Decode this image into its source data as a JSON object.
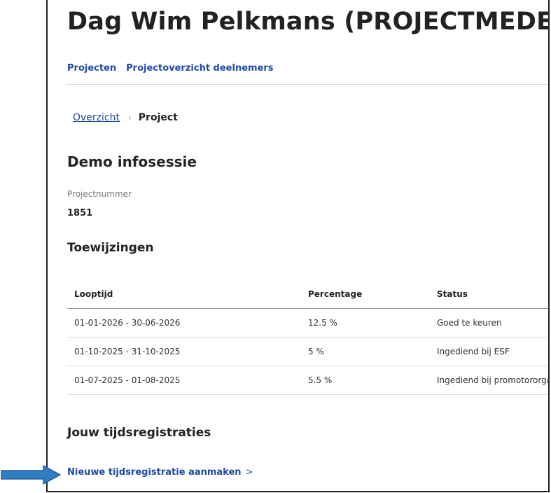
{
  "header": {
    "title": "Dag Wim Pelkmans (PROJECTMEDEWERKER)"
  },
  "nav": {
    "items": [
      {
        "label": "Projecten"
      },
      {
        "label": "Projectoverzicht deelnemers"
      }
    ]
  },
  "breadcrumb": {
    "parent": "Overzicht",
    "separator": "›",
    "current": "Project"
  },
  "project": {
    "title": "Demo infosessie",
    "number_label": "Projectnummer",
    "number": "1851"
  },
  "assignments": {
    "title": "Toewijzingen",
    "columns": [
      "Looptijd",
      "Percentage",
      "Status"
    ],
    "rows": [
      {
        "period": "01-01-2026 - 30-06-2026",
        "percentage": "12.5 %",
        "status": "Goed te keuren"
      },
      {
        "period": "01-10-2025 - 31-10-2025",
        "percentage": "5 %",
        "status": "Ingediend bij ESF"
      },
      {
        "period": "01-07-2025 - 01-08-2025",
        "percentage": "5.5 %",
        "status": "Ingediend bij promotororganisatie"
      }
    ]
  },
  "registrations": {
    "title": "Jouw tijdsregistraties",
    "create_label": "Nieuwe tijdsregistratie aanmaken",
    "create_chevron": ">"
  },
  "colors": {
    "link": "#1f4aa8",
    "arrow": "#2f7dc3",
    "arrow_border": "#1f5d94"
  }
}
